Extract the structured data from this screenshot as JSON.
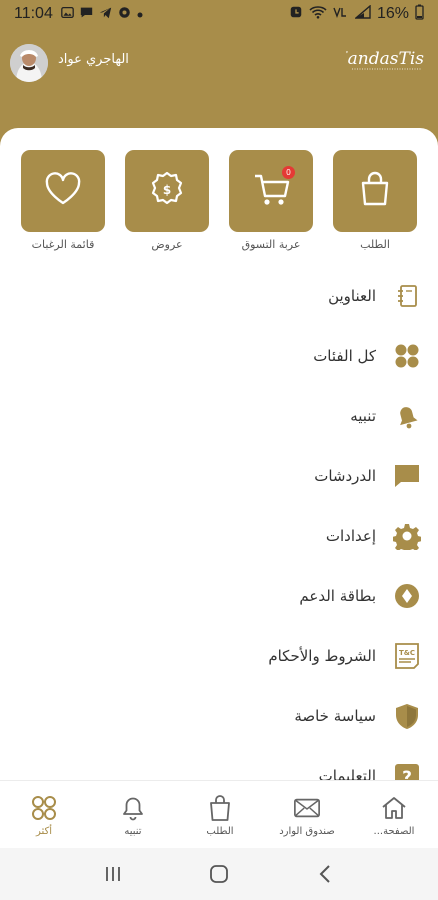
{
  "status_bar": {
    "time": "11:04",
    "battery_text": "16%",
    "left_icons": [
      "image-icon",
      "message-icon",
      "telegram-icon",
      "soccer-icon",
      "dot-icon"
    ],
    "right_icons": [
      "alarm-icon",
      "wifi-icon",
      "volte-icon",
      "signal-icon",
      "battery-icon"
    ]
  },
  "header": {
    "user_name": "الهاجري عواد",
    "brand_logo": "HandasTis"
  },
  "tiles": [
    {
      "label": "الطلب",
      "icon": "shopping-bag-icon"
    },
    {
      "label": "عربة التسوق",
      "icon": "cart-icon",
      "badge": "0"
    },
    {
      "label": "عروض",
      "icon": "offer-badge-icon"
    },
    {
      "label": "قائمة الرغبات",
      "icon": "heart-icon"
    }
  ],
  "menu": [
    {
      "label": "العناوين",
      "icon": "address-book-icon"
    },
    {
      "label": "كل الفئات",
      "icon": "categories-icon"
    },
    {
      "label": "تنبيه",
      "icon": "bell-icon"
    },
    {
      "label": "الدردشات",
      "icon": "chat-icon"
    },
    {
      "label": "إعدادات",
      "icon": "gear-icon"
    },
    {
      "label": "بطاقة الدعم",
      "icon": "support-card-icon"
    },
    {
      "label": "الشروط والأحكام",
      "icon": "terms-icon"
    },
    {
      "label": "سياسة خاصة",
      "icon": "privacy-shield-icon"
    },
    {
      "label": "التعليمات",
      "icon": "help-icon"
    }
  ],
  "bottom_nav": [
    {
      "label": "الصفحة...",
      "icon": "home-icon"
    },
    {
      "label": "صندوق الوارد",
      "icon": "inbox-icon"
    },
    {
      "label": "الطلب",
      "icon": "shopping-bag-icon"
    },
    {
      "label": "تنبيه",
      "icon": "bell-icon"
    },
    {
      "label": "أكثر",
      "icon": "more-grid-icon",
      "active": true
    }
  ],
  "system_nav": [
    "recents-icon",
    "home-button-icon",
    "back-icon"
  ],
  "colors": {
    "accent": "#a88d4a",
    "badge": "#e53935"
  }
}
